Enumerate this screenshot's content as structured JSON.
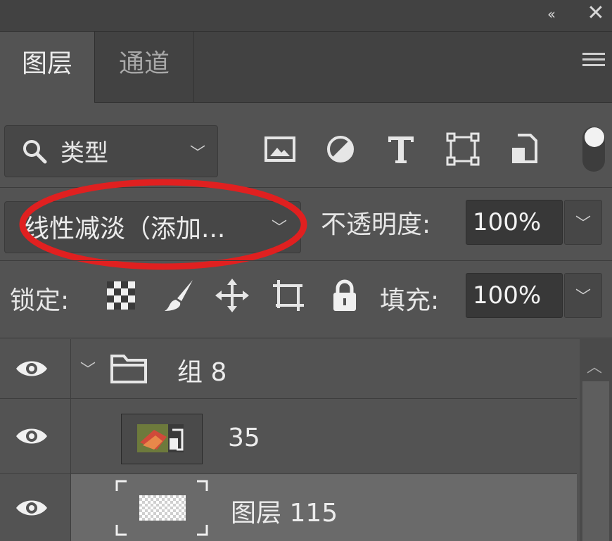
{
  "window": {
    "collapse_glyph": "‹‹",
    "close_glyph": "✕"
  },
  "tabs": [
    {
      "label": "图层",
      "active": true
    },
    {
      "label": "通道",
      "active": false
    }
  ],
  "filter": {
    "kind_label": "类型",
    "icons": [
      "image-filter-icon",
      "adjustment-filter-icon",
      "type-filter-icon",
      "shape-filter-icon",
      "smart-object-filter-icon"
    ],
    "toggle_on": true
  },
  "blend": {
    "mode_label": "线性减淡（添加...",
    "highlight_color": "#e02020"
  },
  "opacity": {
    "label": "不透明度:",
    "value": "100%"
  },
  "lock": {
    "label": "锁定:",
    "icons": [
      "lock-transparent-pixels-icon",
      "lock-image-pixels-icon",
      "lock-position-icon",
      "lock-artboard-icon",
      "lock-all-icon"
    ]
  },
  "fill": {
    "label": "填充:",
    "value": "100%"
  },
  "layers": [
    {
      "name": "组 8",
      "type": "group",
      "expanded": true,
      "visible": true,
      "selected": false
    },
    {
      "name": "35",
      "type": "smart-object",
      "visible": true,
      "selected": false
    },
    {
      "name": "图层 115",
      "type": "pixel",
      "visible": true,
      "selected": true
    }
  ],
  "colors": {
    "panel_bg": "#535353",
    "header_bg": "#424242",
    "selected_row": "#6a6a6a"
  }
}
